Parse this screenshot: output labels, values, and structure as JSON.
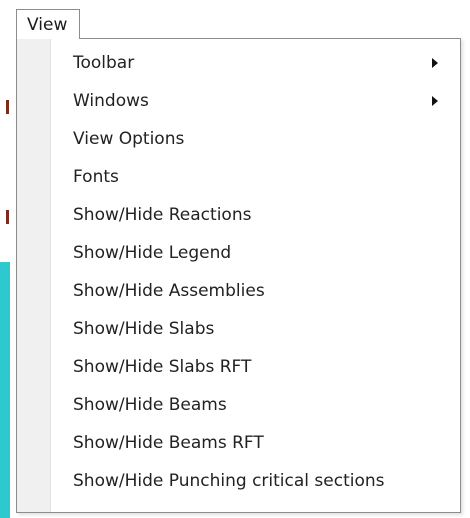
{
  "menubar": {
    "view_label": "View"
  },
  "menu": {
    "items": [
      {
        "label": "Toolbar",
        "submenu": true
      },
      {
        "label": "Windows",
        "submenu": true
      },
      {
        "label": "View Options",
        "submenu": false
      },
      {
        "label": "Fonts",
        "submenu": false
      },
      {
        "label": "Show/Hide Reactions",
        "submenu": false
      },
      {
        "label": "Show/Hide Legend",
        "submenu": false
      },
      {
        "label": "Show/Hide Assemblies",
        "submenu": false
      },
      {
        "label": "Show/Hide Slabs",
        "submenu": false
      },
      {
        "label": "Show/Hide Slabs RFT",
        "submenu": false
      },
      {
        "label": "Show/Hide Beams",
        "submenu": false
      },
      {
        "label": "Show/Hide Beams RFT",
        "submenu": false
      },
      {
        "label": "Show/Hide Punching critical sections",
        "submenu": false
      }
    ]
  },
  "colors": {
    "border": "#8c8c8c",
    "gutter": "#f0f0f0",
    "text": "#222222",
    "background_accent": "#2ec9cf"
  }
}
